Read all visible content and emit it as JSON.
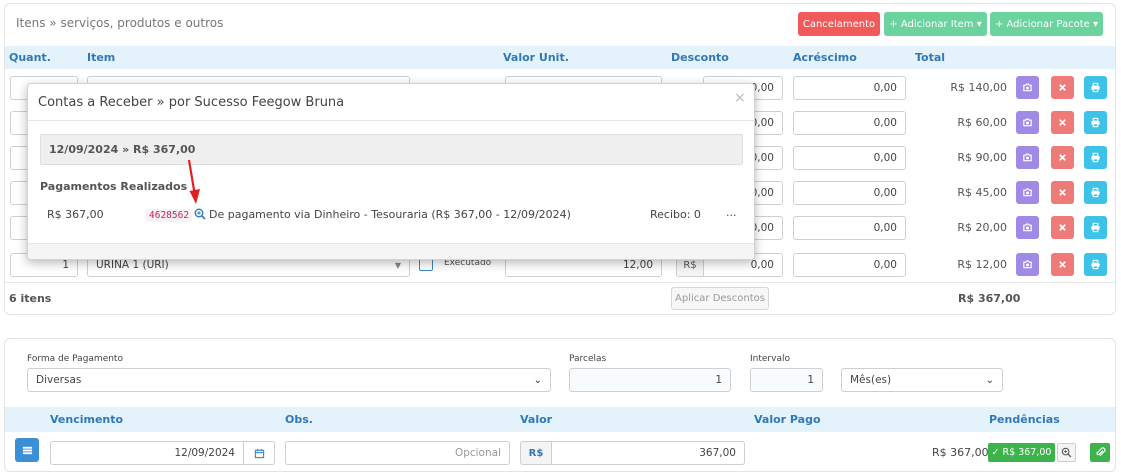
{
  "items_panel": {
    "breadcrumb": "Itens » serviços, produtos e outros",
    "buttons": {
      "cancel": "Cancelamento",
      "add_item": "+ Adicionar Item ▾",
      "add_package": "+ Adicionar Pacote ▾"
    },
    "columns": {
      "quant": "Quant.",
      "item": "Item",
      "unit_value": "Valor Unit.",
      "discount": "Desconto",
      "addition": "Acréscimo",
      "total": "Total"
    },
    "rows": [
      {
        "discount": "0,00",
        "addition": "0,00",
        "total": "R$ 140,00"
      },
      {
        "discount": "0,00",
        "addition": "0,00",
        "total": "R$ 60,00"
      },
      {
        "discount": "0,00",
        "addition": "0,00",
        "total": "R$ 90,00"
      },
      {
        "discount": "0,00",
        "addition": "0,00",
        "total": "R$ 45,00"
      },
      {
        "discount": "0,00",
        "addition": "0,00",
        "total": "R$ 20,00"
      },
      {
        "quant": "1",
        "item": "URINA 1 (URI)",
        "status": "Executado",
        "unit_value": "12,00",
        "currency": "R$",
        "discount": "0,00",
        "addition": "0,00",
        "total": "R$ 12,00"
      }
    ],
    "footer": {
      "count": "6 itens",
      "apply_discounts": "Aplicar Descontos",
      "grand_total": "R$ 367,00"
    }
  },
  "modal": {
    "title": "Contas a Receber",
    "title_suffix": " » por Sucesso Feegow Bruna",
    "close": "×",
    "bar_text": "12/09/2024 » R$ 367,00",
    "payments_heading": "Pagamentos Realizados",
    "payment": {
      "amount": "R$ 367,00",
      "code": "4628562",
      "description": "De pagamento via Dinheiro - Tesouraria (R$ 367,00 - 12/09/2024)",
      "receipt": "Recibo: 0",
      "more": "..."
    }
  },
  "payment_panel": {
    "form_label": "Forma de Pagamento",
    "form_value": "Diversas",
    "parcelas_label": "Parcelas",
    "parcelas_value": "1",
    "intervalo_label": "Intervalo",
    "intervalo_value": "1",
    "unit_value": "Mês(es)",
    "columns": {
      "due": "Vencimento",
      "obs": "Obs.",
      "value": "Valor",
      "paid": "Valor Pago",
      "pending": "Pendências"
    },
    "row": {
      "date": "12/09/2024",
      "obs_placeholder": "Opcional",
      "currency": "R$",
      "value": "367,00",
      "paid": "R$ 367,00",
      "badge": "✓ R$ 367,00"
    }
  },
  "colors": {
    "accent_blue": "#2f79b8",
    "header_bg": "#e4f2fb",
    "red": "#f05a5a",
    "green": "#6ad39e",
    "purple": "#a08ae6",
    "cyan": "#3fc2e8"
  }
}
